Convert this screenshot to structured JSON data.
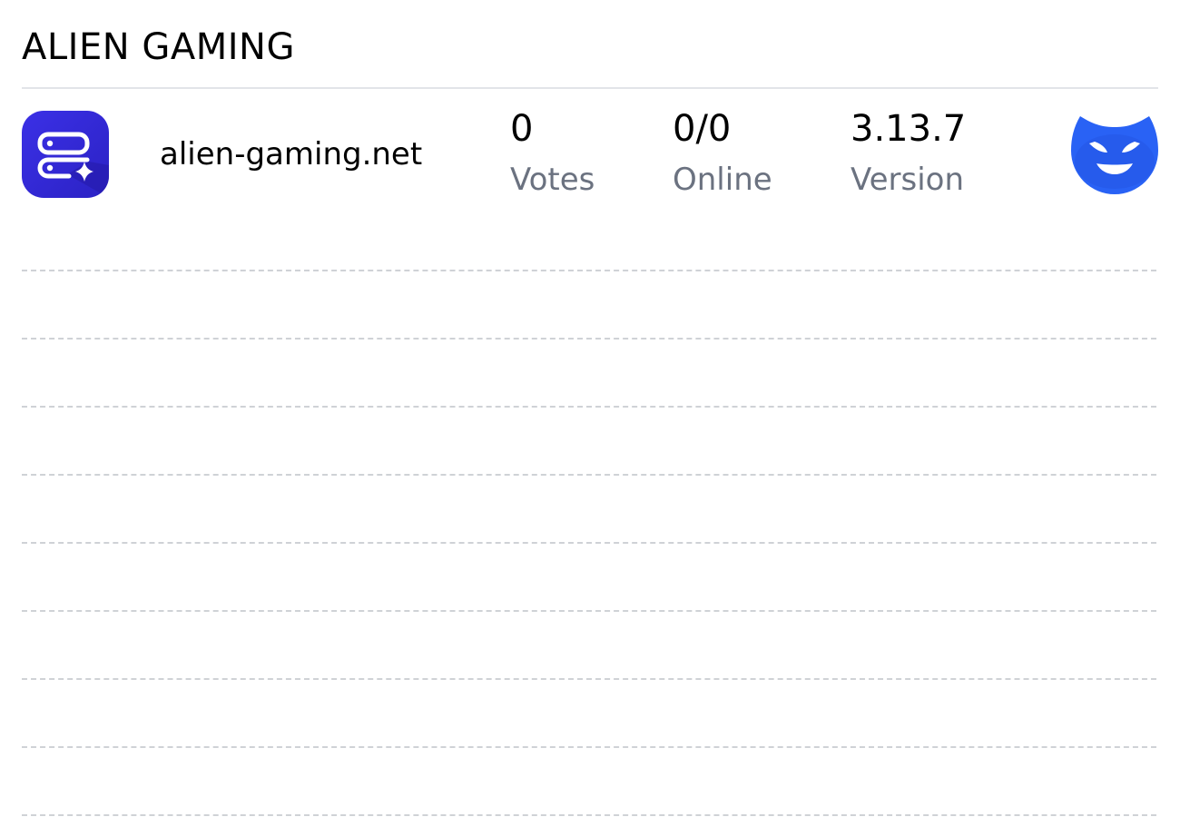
{
  "page": {
    "title": "ALIEN GAMING"
  },
  "server": {
    "icon": "server-sparkle-icon",
    "hostname": "alien-gaming.net",
    "stats": [
      {
        "value": "0",
        "label": "Votes"
      },
      {
        "value": "0/0",
        "label": "Online"
      },
      {
        "value": "3.13.7",
        "label": "Version"
      }
    ],
    "owner_avatar": "devil-face-icon"
  },
  "colors": {
    "icon_gradient_start": "#3b2fe0",
    "icon_gradient_end": "#2a22c0",
    "avatar_blue": "#2962f5",
    "label_gray": "#6b7280",
    "divider": "#cfd2d6"
  }
}
